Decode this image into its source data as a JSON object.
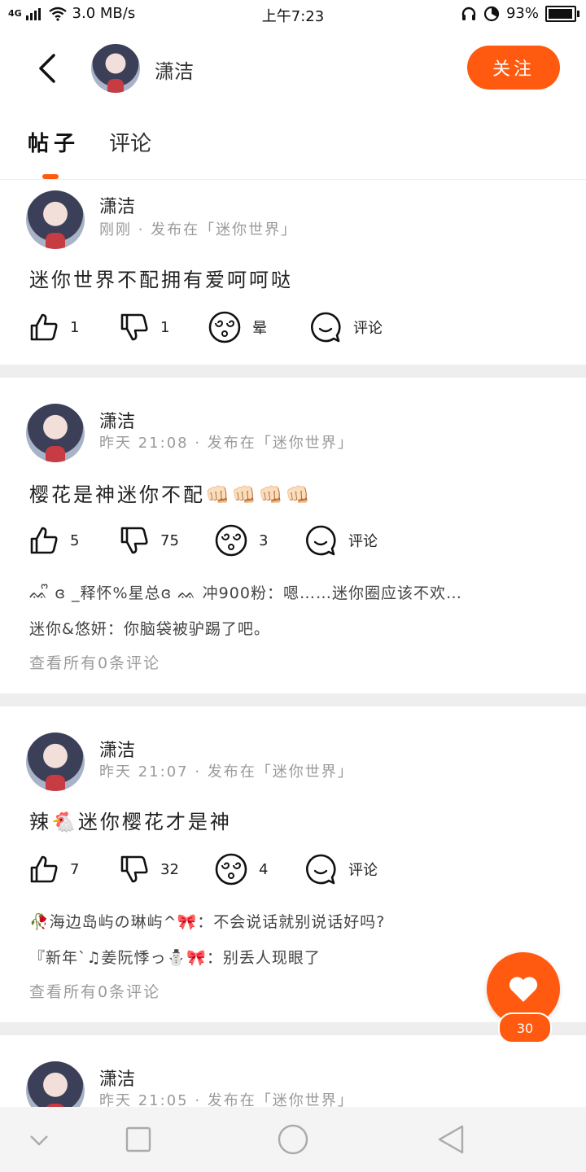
{
  "status": {
    "network": "4G",
    "speed": "3.0 MB/s",
    "time": "上午7:23",
    "battery": "93%",
    "battery_level": 0.93
  },
  "header": {
    "name": "潇洁",
    "follow_label": "关注"
  },
  "tabs": [
    {
      "label": "帖子",
      "active": true
    },
    {
      "label": "评论",
      "active": false
    }
  ],
  "posts": [
    {
      "author": "潇洁",
      "meta": "刚刚 · 发布在「迷你世界」",
      "content": "迷你世界不配拥有爱呵呵哒",
      "likes": "1",
      "dislikes": "1",
      "dizzy": "晕",
      "comment_label": "评论",
      "comments": [],
      "view_all": ""
    },
    {
      "author": "潇洁",
      "meta": "昨天 21:08 · 发布在「迷你世界」",
      "content": "樱花是神迷你不配👊🏻👊🏻👊🏻👊🏻",
      "likes": "5",
      "dislikes": "75",
      "dizzy": "3",
      "comment_label": "评论",
      "comments": [
        "ᨐᩚ ɞ _释怀%星总ɞ ᨐ 冲900粉：嗯……迷你圈应该不欢…",
        "迷你&悠妍：你脑袋被驴踢了吧。"
      ],
      "view_all": "查看所有0条评论"
    },
    {
      "author": "潇洁",
      "meta": "昨天 21:07 · 发布在「迷你世界」",
      "content": "辣🐔迷你樱花才是神",
      "likes": "7",
      "dislikes": "32",
      "dizzy": "4",
      "comment_label": "评论",
      "comments": [
        "🥀海边岛屿の琳屿^🎀：不会说话就别说话好吗?",
        "『新年`♫姜阮悸っ⛄🎀：别丢人现眼了"
      ],
      "view_all": "查看所有0条评论"
    },
    {
      "author": "潇洁",
      "meta": "昨天 21:05 · 发布在「迷你世界」",
      "content": ""
    }
  ],
  "fab": {
    "count": "30"
  },
  "icons": {
    "back": "back-arrow-icon",
    "like": "thumbs-up-icon",
    "dislike": "thumbs-down-icon",
    "dizzy": "dizzy-face-icon",
    "comment": "comment-bubble-icon",
    "heart": "heart-icon"
  },
  "colors": {
    "accent": "#ff5a0f",
    "separator": "#eeeeee",
    "meta": "#9a9a9a"
  }
}
